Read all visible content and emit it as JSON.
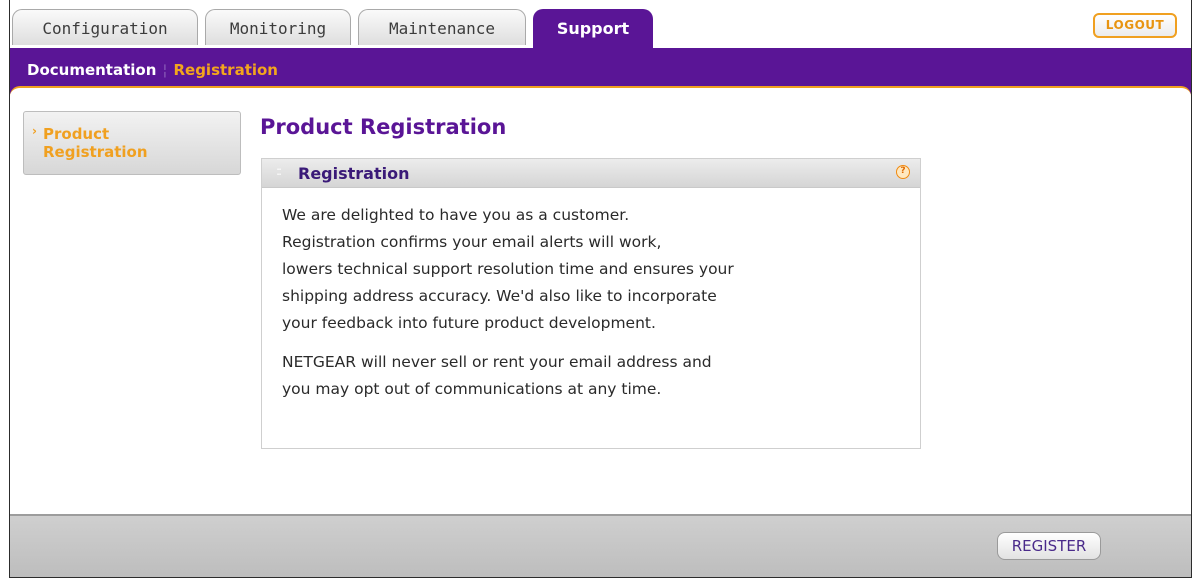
{
  "tabs": [
    {
      "label": "Configuration",
      "active": false
    },
    {
      "label": "Monitoring",
      "active": false
    },
    {
      "label": "Maintenance",
      "active": false
    },
    {
      "label": "Support",
      "active": true
    }
  ],
  "logout_label": "LOGOUT",
  "subnav": {
    "items": [
      "Documentation",
      "Registration"
    ],
    "separator": "¦"
  },
  "sidebar": {
    "items": [
      {
        "label": "Product Registration",
        "active": true
      }
    ]
  },
  "main": {
    "title": "Product Registration",
    "panel": {
      "title": "Registration",
      "paragraph1_lines": [
        "We are delighted to have you as a customer.",
        "Registration confirms your email alerts will work,",
        "lowers technical support resolution time and ensures your",
        "shipping address accuracy. We'd also like to incorporate",
        "your feedback into future product development."
      ],
      "paragraph2_lines": [
        "NETGEAR will never sell or rent your email address and",
        "you may opt out of communications at any time."
      ]
    }
  },
  "footer": {
    "register_label": "REGISTER"
  },
  "icons": {
    "help": "help-icon",
    "sidebar_arrow": "chevron-right-icon",
    "panel_grip": "drag-handle-icon"
  },
  "colors": {
    "brand_purple": "#5a1596",
    "accent_orange": "#f0a020"
  }
}
